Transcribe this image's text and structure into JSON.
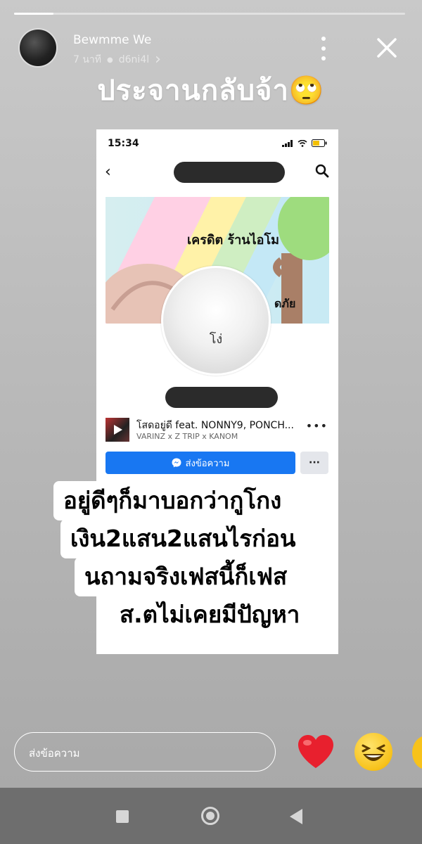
{
  "story": {
    "progress": 0.1
  },
  "header": {
    "username": "Bewmme We",
    "time_ago": "7 นาที",
    "audience": "d6ni4l",
    "icons": {
      "more": "more-vertical-icon",
      "close": "close-icon",
      "chevron": "chevron-right-icon"
    }
  },
  "caption": "ประจานกลับจ้า🙄",
  "screenshot": {
    "status_time": "15:34",
    "cover_text_1": "เครดิต ร้านไอโม",
    "cover_text_2": "ดภัย",
    "profile_label": "โง่",
    "song_title": "โสดอยู่ดี feat. NONNY9, PONCH...",
    "song_artists": "VARINZ x Z TRIP x KANOM",
    "message_button": "ส่งข้อความ",
    "more_button": "···"
  },
  "overlay": {
    "line1": "อยู่ดีๆก็มาบอกว่ากูโกง",
    "line2": "เงิน2แสน2แสนไรก่อน",
    "line3": "นถามจริงเฟสนี้ก็เฟส",
    "line4": "ส.ตไม่เคยมีปัญหา"
  },
  "reply": {
    "placeholder": "ส่งข้อความ",
    "reactions": [
      "heart-icon",
      "laughing-face-icon"
    ]
  },
  "colors": {
    "messenger_blue": "#1877f2",
    "heart_red": "#e8202e",
    "story_background": "#bdbdbd"
  }
}
